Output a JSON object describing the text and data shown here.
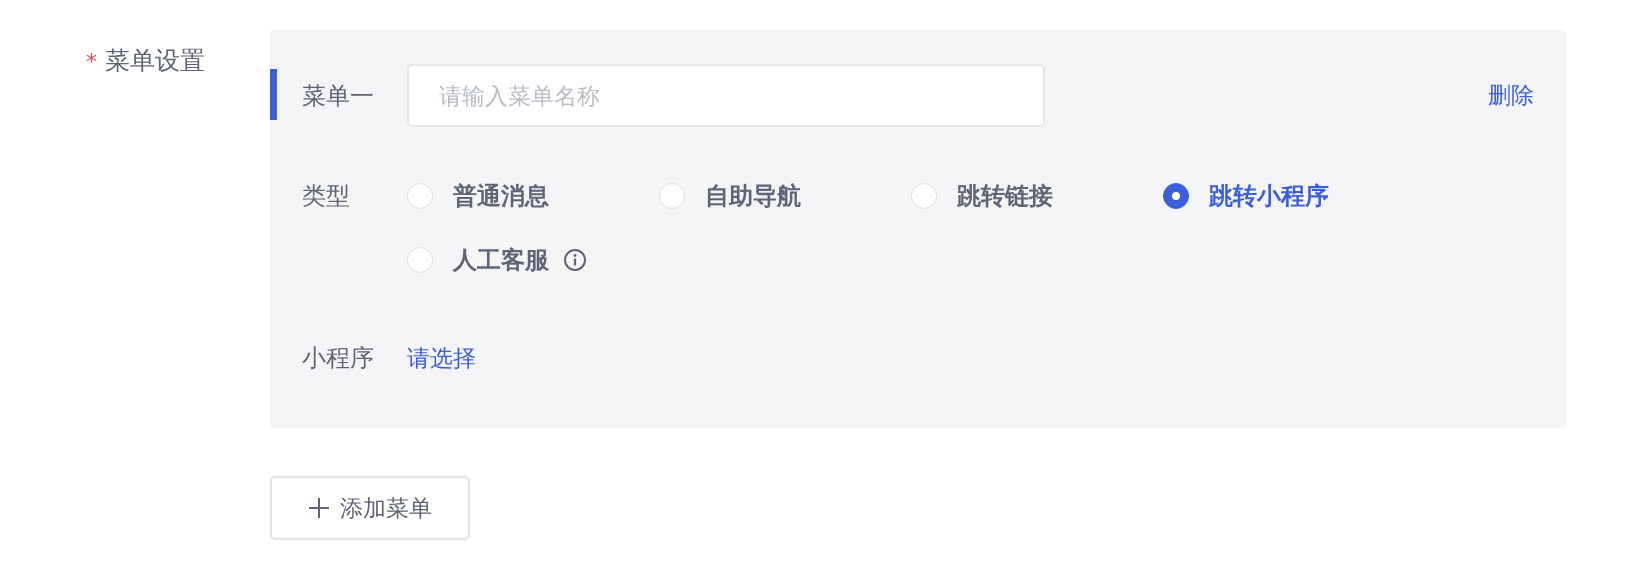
{
  "form_label": {
    "required_mark": "*",
    "text": "菜单设置"
  },
  "menus": [
    {
      "title": "菜单一",
      "name_field": {
        "placeholder": "请输入菜单名称"
      },
      "delete": "删除",
      "type_label": "类型",
      "types": [
        {
          "label": "普通消息",
          "selected": false,
          "info": false
        },
        {
          "label": "自助导航",
          "selected": false,
          "info": false
        },
        {
          "label": "跳转链接",
          "selected": false,
          "info": false
        },
        {
          "label": "跳转小程序",
          "selected": true,
          "info": false
        },
        {
          "label": "人工客服",
          "selected": false,
          "info": true
        }
      ],
      "target_label": "小程序",
      "target_action": "请选择"
    }
  ],
  "add_button": "添加菜单"
}
